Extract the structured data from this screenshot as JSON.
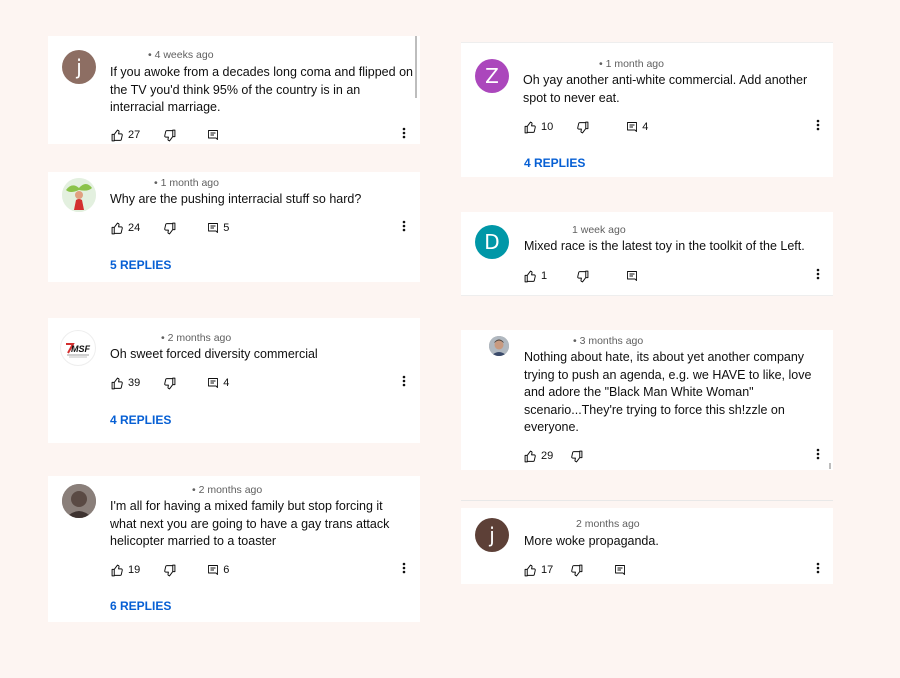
{
  "comments": [
    {
      "id": "c1",
      "avatar": {
        "letter": "j",
        "bg": "#8d6e63"
      },
      "time": "• 4 weeks ago",
      "text": [
        "If you awoke from a decades long coma and flipped on",
        "the TV you'd think 95% of the country is in an",
        "interracial marriage."
      ],
      "likes": "27",
      "replies_count": "",
      "replies_link": ""
    },
    {
      "id": "c2",
      "avatar": {
        "letter": "",
        "bg": "#e8f4e8"
      },
      "time": "• 1 month ago",
      "text": [
        "Why are the pushing interracial stuff so hard?"
      ],
      "likes": "24",
      "replies_count": "5",
      "replies_link": "5 REPLIES"
    },
    {
      "id": "c3",
      "avatar": {
        "letter": "",
        "bg": "#ffffff",
        "logo_text": "MSF"
      },
      "time": "• 2 months ago",
      "text": [
        "Oh sweet forced diversity commercial"
      ],
      "likes": "39",
      "replies_count": "4",
      "replies_link": "4 REPLIES"
    },
    {
      "id": "c4",
      "avatar": {
        "letter": "",
        "bg": "#6d6260"
      },
      "time": "• 2 months ago",
      "text": [
        "I'm all for having a mixed family but stop forcing it",
        "what next you are going to have  a gay trans attack",
        "helicopter married to a toaster"
      ],
      "likes": "19",
      "replies_count": "6",
      "replies_link": "6 REPLIES"
    },
    {
      "id": "c5",
      "avatar": {
        "letter": "Z",
        "bg": "#ab47bc"
      },
      "time": "• 1 month ago",
      "text": [
        "Oh yay another anti-white commercial. Add another",
        "spot to never eat."
      ],
      "likes": "10",
      "replies_count": "4",
      "replies_link": "4 REPLIES"
    },
    {
      "id": "c6",
      "avatar": {
        "letter": "D",
        "bg": "#0097a7"
      },
      "time": "1 week ago",
      "text": [
        "Mixed race is the latest toy in the toolkit of the Left."
      ],
      "likes": "1",
      "replies_count": "",
      "replies_link": ""
    },
    {
      "id": "c7",
      "avatar": {
        "letter": "",
        "bg": "#9e9e9e"
      },
      "time": "• 3 months ago",
      "text": [
        "Nothing about hate, its about yet another company",
        "trying to push an agenda, e.g. we HAVE to like, love",
        "and adore  the \"Black Man White Woman\"",
        "scenario...They're trying to force this sh!zzle on",
        "everyone."
      ],
      "likes": "29",
      "replies_count": "",
      "replies_link": ""
    },
    {
      "id": "c8",
      "avatar": {
        "letter": "j",
        "bg": "#5d4037"
      },
      "time": "2 months ago",
      "text": [
        "More woke propaganda."
      ],
      "likes": "17",
      "replies_count": "",
      "replies_link": ""
    }
  ],
  "icons": {
    "like": "thumb-up-icon",
    "dislike": "thumb-down-icon",
    "reply": "reply-comment-icon",
    "more": "more-vertical-icon"
  }
}
